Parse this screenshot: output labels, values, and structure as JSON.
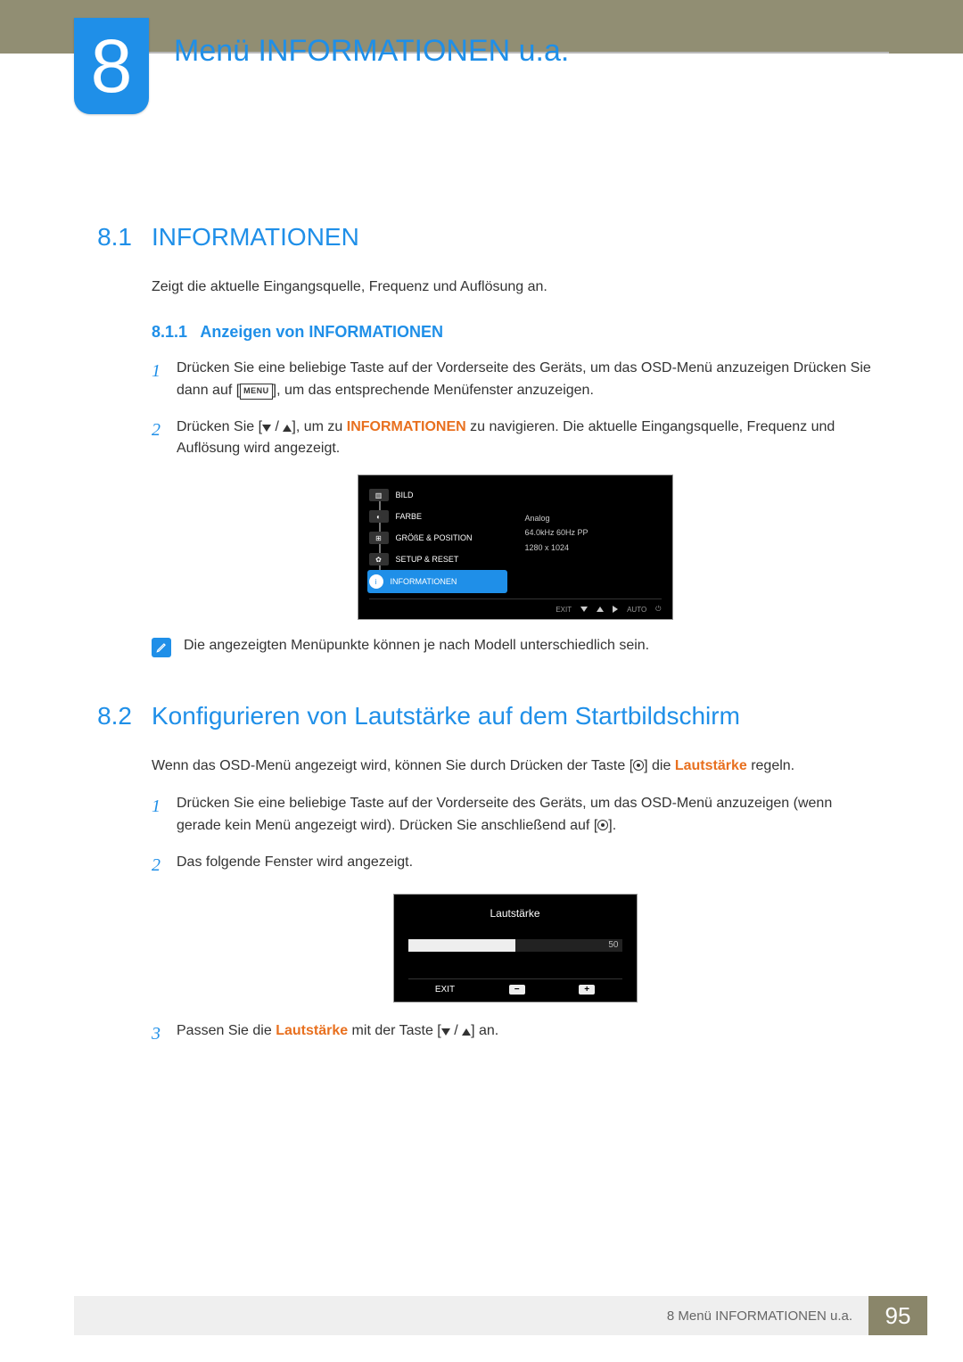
{
  "chapter": {
    "number": "8",
    "title": "Menü INFORMATIONEN u.a."
  },
  "sec81": {
    "num": "8.1",
    "title": "INFORMATIONEN",
    "intro": "Zeigt die aktuelle Eingangsquelle, Frequenz und Auflösung an.",
    "sub_num": "8.1.1",
    "sub_title": "Anzeigen von INFORMATIONEN",
    "step1a": "Drücken Sie eine beliebige Taste auf der Vorderseite des Geräts, um das OSD-Menü anzuzeigen Drücken Sie dann auf [",
    "step1b": "], um das entsprechende Menüfenster anzuzeigen.",
    "menu_label": "MENU",
    "step2a": "Drücken Sie [",
    "step2b": "], um zu ",
    "step2_nav": "INFORMATIONEN",
    "step2c": " zu navigieren. Die aktuelle Eingangsquelle, Frequenz und Auflösung wird angezeigt."
  },
  "osd": {
    "items": [
      "BILD",
      "FARBE",
      "GRÖßE & POSITION",
      "SETUP & RESET",
      "INFORMATIONEN"
    ],
    "info_lines": [
      "Analog",
      "64.0kHz 60Hz PP",
      "1280 x 1024"
    ],
    "footer": {
      "exit": "EXIT",
      "auto": "AUTO"
    }
  },
  "note": "Die angezeigten Menüpunkte können je nach Modell unterschiedlich sein.",
  "sec82": {
    "num": "8.2",
    "title": "Konfigurieren von Lautstärke auf dem Startbildschirm",
    "intro_a": "Wenn das OSD-Menü angezeigt wird, können Sie durch Drücken der Taste [",
    "intro_b": "] die ",
    "intro_hl": "Lautstärke",
    "intro_c": " regeln.",
    "step1a": "Drücken Sie eine beliebige Taste auf der Vorderseite des Geräts, um das OSD-Menü anzuzeigen (wenn gerade kein Menü angezeigt wird). Drücken Sie anschließend auf [",
    "step1b": "].",
    "step2": "Das folgende Fenster wird angezeigt.",
    "step3a": "Passen Sie die ",
    "step3_hl": "Lautstärke",
    "step3b": " mit der Taste [",
    "step3c": "] an."
  },
  "volume_panel": {
    "title": "Lautstärke",
    "value": "50",
    "exit": "EXIT"
  },
  "footer": {
    "text": "8 Menü INFORMATIONEN u.a.",
    "page": "95"
  }
}
